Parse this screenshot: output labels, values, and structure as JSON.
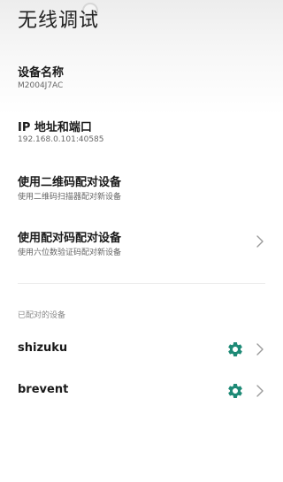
{
  "header": {
    "title": "无线调试"
  },
  "items": [
    {
      "title": "设备名称",
      "subtitle": "M2004J7AC"
    },
    {
      "title": "IP 地址和端口",
      "subtitle": "192.168.0.101:40585"
    },
    {
      "title": "使用二维码配对设备",
      "subtitle": "使用二维码扫描器配对新设备"
    },
    {
      "title": "使用配对码配对设备",
      "subtitle": "使用六位数验证码配对新设备"
    }
  ],
  "paired": {
    "section_label": "已配对的设备",
    "devices": [
      {
        "name": "shizuku"
      },
      {
        "name": "brevent"
      }
    ]
  },
  "colors": {
    "accent": "#1e8a76",
    "chevron": "#9a9a9a"
  },
  "icons": {
    "settings": "gear-icon",
    "navigate": "chevron-right-icon"
  }
}
